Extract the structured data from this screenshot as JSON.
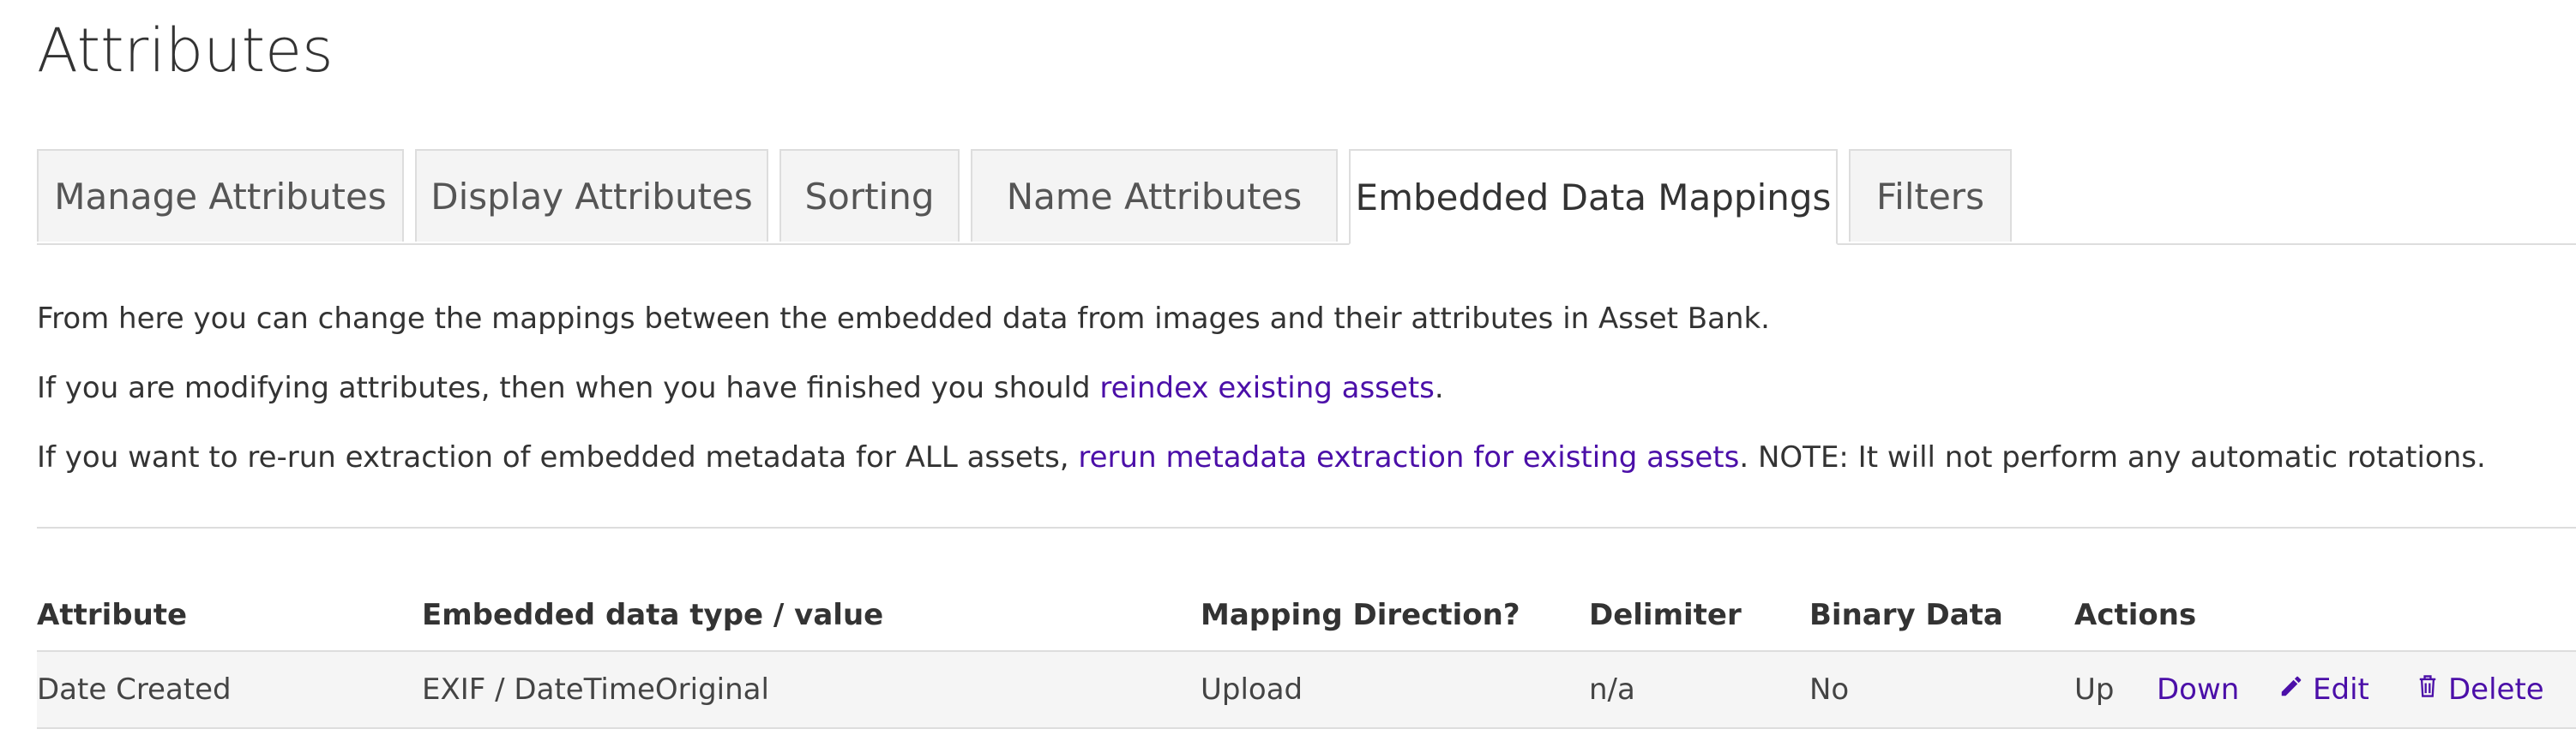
{
  "page_title": "Attributes",
  "tabs": [
    {
      "label": "Manage Attributes",
      "active": false
    },
    {
      "label": "Display Attributes",
      "active": false
    },
    {
      "label": "Sorting",
      "active": false
    },
    {
      "label": "Name Attributes",
      "active": false
    },
    {
      "label": "Embedded Data Mappings",
      "active": true
    },
    {
      "label": "Filters",
      "active": false
    }
  ],
  "intro": {
    "line1": "From here you can change the mappings between the embedded data from images and their attributes in Asset Bank.",
    "line2_prefix": "If you are modifying attributes, then when you have finished you should ",
    "line2_link": "reindex existing assets",
    "line2_suffix": ".",
    "line3_prefix": "If you want to re-run extraction of embedded metadata for ALL assets, ",
    "line3_link": "rerun metadata extraction for existing assets",
    "line3_suffix": ". NOTE: It will not perform any automatic rotations."
  },
  "table": {
    "headers": {
      "attribute": "Attribute",
      "embedded": "Embedded data type / value",
      "direction": "Mapping Direction?",
      "delimiter": "Delimiter",
      "binary": "Binary Data",
      "actions": "Actions"
    },
    "rows": [
      {
        "attribute": "Date Created",
        "embedded": "EXIF / DateTimeOriginal",
        "direction": "Upload",
        "delimiter": "n/a",
        "binary": "No",
        "actions": {
          "up": "Up",
          "down": "Down",
          "edit": "Edit",
          "delete": "Delete"
        }
      }
    ]
  },
  "colors": {
    "link": "#4b0fa8",
    "tab_bg": "#f4f4f4",
    "border": "#dddddd"
  },
  "icons": {
    "edit": "pencil-icon",
    "delete": "trash-icon"
  }
}
